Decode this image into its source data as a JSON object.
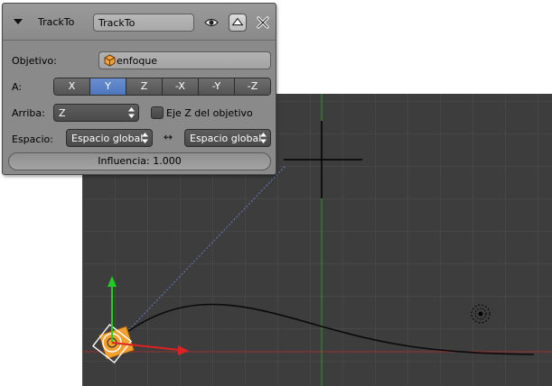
{
  "panel": {
    "title": "TrackTo",
    "name_value": "TrackTo",
    "icons": [
      "eye-icon",
      "move-up-icon",
      "close-icon",
      "collapse-triangle-icon"
    ],
    "target": {
      "label": "Objetivo:",
      "value": "enfoque",
      "icon": "object-icon"
    },
    "to": {
      "label": "A:",
      "axes": [
        "X",
        "Y",
        "Z",
        "-X",
        "-Y",
        "-Z"
      ],
      "selected": "Y"
    },
    "up": {
      "label": "Arriba:",
      "value": "Z",
      "checkbox_label": "Eje Z del objetivo",
      "checkbox_checked": false
    },
    "space": {
      "label": "Espacio:",
      "owner_value": "Espacio global",
      "target_value": "Espacio global",
      "arrow_symbol": "↔"
    },
    "influence": {
      "text": "Influencia: 1.000",
      "value": 1.0
    }
  },
  "viewport": {
    "colors": {
      "background": "#3d3d3d",
      "grid": "#474747",
      "x_axis": "#9b3030",
      "y_axis": "#1fa11f",
      "curve": "#0a0a0a",
      "camera_body": "#f0a030",
      "gizmo_z": "#22cc22",
      "gizmo_x": "#dd2222"
    }
  }
}
